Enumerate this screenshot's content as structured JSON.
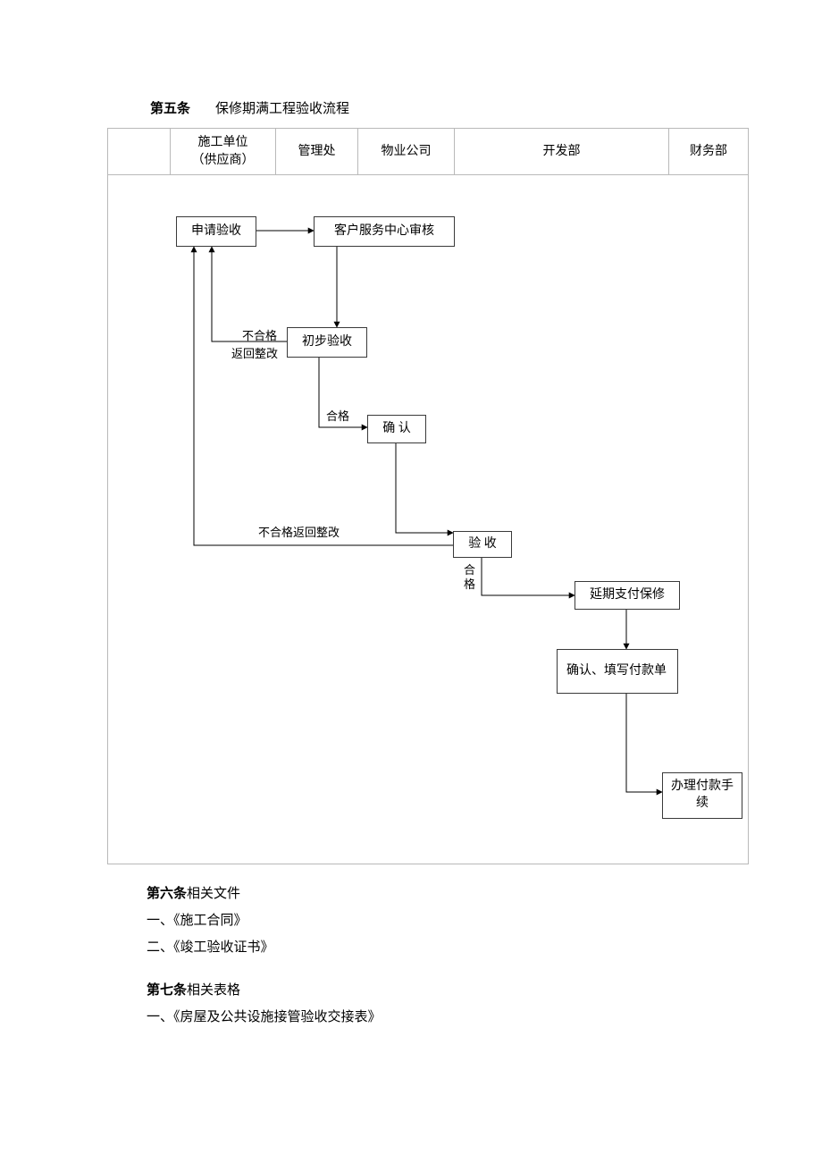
{
  "chart_data": {
    "type": "table",
    "note": "Swimlane flowchart (cross-functional). Lanes are table columns; nodes below are placed within those lanes.",
    "lanes": [
      {
        "id": "margin",
        "label": ""
      },
      {
        "id": "contractor",
        "label": "施工单位\n（供应商）"
      },
      {
        "id": "mgmt",
        "label": "管理处"
      },
      {
        "id": "property",
        "label": "物业公司"
      },
      {
        "id": "dev",
        "label": "开发部"
      },
      {
        "id": "finance",
        "label": "财务部"
      }
    ],
    "nodes": [
      {
        "id": "apply",
        "lane": "contractor",
        "label": "申请验收"
      },
      {
        "id": "csAudit",
        "lane": "mgmt/property",
        "label": "客户服务中心审核"
      },
      {
        "id": "prelim",
        "lane": "mgmt",
        "label": "初步验收"
      },
      {
        "id": "confirm1",
        "lane": "property",
        "label": "确 认"
      },
      {
        "id": "accept",
        "lane": "dev",
        "label": "验 收"
      },
      {
        "id": "defer",
        "lane": "dev",
        "label": "延期支付保修"
      },
      {
        "id": "fillPay",
        "lane": "dev",
        "label": "确认、填写付款单"
      },
      {
        "id": "doPay",
        "lane": "finance",
        "label": "办理付款手续"
      }
    ],
    "edges": [
      {
        "from": "apply",
        "to": "csAudit",
        "label": ""
      },
      {
        "from": "csAudit",
        "to": "prelim",
        "label": ""
      },
      {
        "from": "prelim",
        "to": "apply",
        "label": "不合格 返回整改"
      },
      {
        "from": "prelim",
        "to": "confirm1",
        "label": "合格"
      },
      {
        "from": "confirm1",
        "to": "accept",
        "label": ""
      },
      {
        "from": "accept",
        "to": "apply",
        "label": "不合格返回整改"
      },
      {
        "from": "accept",
        "to": "defer",
        "label": "合格"
      },
      {
        "from": "defer",
        "to": "fillPay",
        "label": ""
      },
      {
        "from": "fillPay",
        "to": "doPay",
        "label": ""
      }
    ]
  },
  "headings": {
    "art5_no": "第五条",
    "art5_title": "保修期满工程验收流程",
    "art6_no": "第六条",
    "art6_title": "相关文件",
    "art7_no": "第七条",
    "art7_title": "相关表格"
  },
  "swimlanes": {
    "blank": "",
    "contractor": "施工单位\n（供应商）",
    "mgmt": "管理处",
    "property": "物业公司",
    "dev": "开发部",
    "finance": "财务部"
  },
  "boxes": {
    "apply": "申请验收",
    "csAudit": "客户服务中心审核",
    "prelim": "初步验收",
    "confirm1": "确 认",
    "accept": "验 收",
    "deferPay": "延期支付保修",
    "fillPay": "确认、填写付款单",
    "doPay": "办理付款手续"
  },
  "labels": {
    "fail1a": "不合格",
    "fail1b": "返回整改",
    "pass1": "合格",
    "fail2": "不合格返回整改",
    "pass2": "合格"
  },
  "lists": {
    "art6_items": [
      "一、《施工合同》",
      "二、《竣工验收证书》"
    ],
    "art7_items": [
      "一、《房屋及公共设施接管验收交接表》"
    ]
  }
}
